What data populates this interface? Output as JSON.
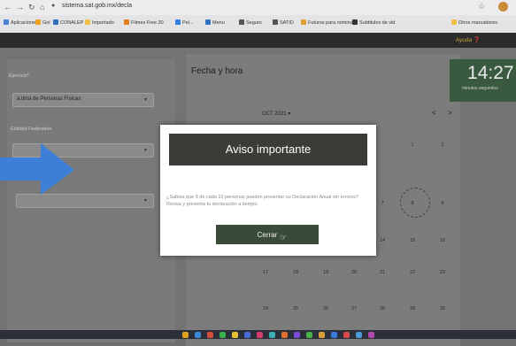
{
  "browser": {
    "url": "sistema.sat.gob.mx/decla",
    "bookmarks": [
      {
        "label": "Aplicaciones",
        "color": "#4a80d8"
      },
      {
        "label": "Gol",
        "color": "#f0a020"
      },
      {
        "label": "CONALEP",
        "color": "#3070c0"
      },
      {
        "label": "Importado",
        "color": "#f0c040"
      },
      {
        "label": "Filmes Free 30",
        "color": "#e08020"
      },
      {
        "label": "Pel...",
        "color": "#3080e0"
      },
      {
        "label": "Menu",
        "color": "#3070c0"
      },
      {
        "label": "Seguro",
        "color": "#555555"
      },
      {
        "label": "SATID",
        "color": "#555555"
      },
      {
        "label": "Futuros para nomina",
        "color": "#e0a030"
      },
      {
        "label": "Subtitulos de vid",
        "color": "#333333"
      },
      {
        "label": "Otros marcadores",
        "color": "#f0c040"
      }
    ]
  },
  "header": {
    "help": "Ayuda ❓"
  },
  "form": {
    "field1_label": "Ejercicio*",
    "field1_value": "a.tima de Personas Físicas",
    "field2_label": "Entidad Federativa",
    "field2_value": "",
    "field3_value": ""
  },
  "calendar": {
    "section_title": "Fecha y hora",
    "month": "OCT 2021 ▾",
    "prev": "<",
    "next": ">",
    "days": [
      "1",
      "2",
      "7",
      "8",
      "9",
      "14",
      "15",
      "16",
      "17",
      "18",
      "19",
      "20",
      "21",
      "22",
      "23",
      "24",
      "25",
      "26",
      "27",
      "28",
      "29",
      "30"
    ]
  },
  "clock": {
    "time": "14:27",
    "units": "minutos  segundos"
  },
  "modal": {
    "title": "Aviso importante",
    "body": "¿Sabías que 9 de cada 10 personas pueden presentar su Declaración Anual sin errores? Revisa y presenta tu declaración a tiempo.",
    "close_label": "Cerrar"
  },
  "colors": {
    "modal_header": "#3b3b38",
    "close_button": "#394a38",
    "arrow": "#3d7fd6",
    "clock_bg": "#3a5a40"
  }
}
